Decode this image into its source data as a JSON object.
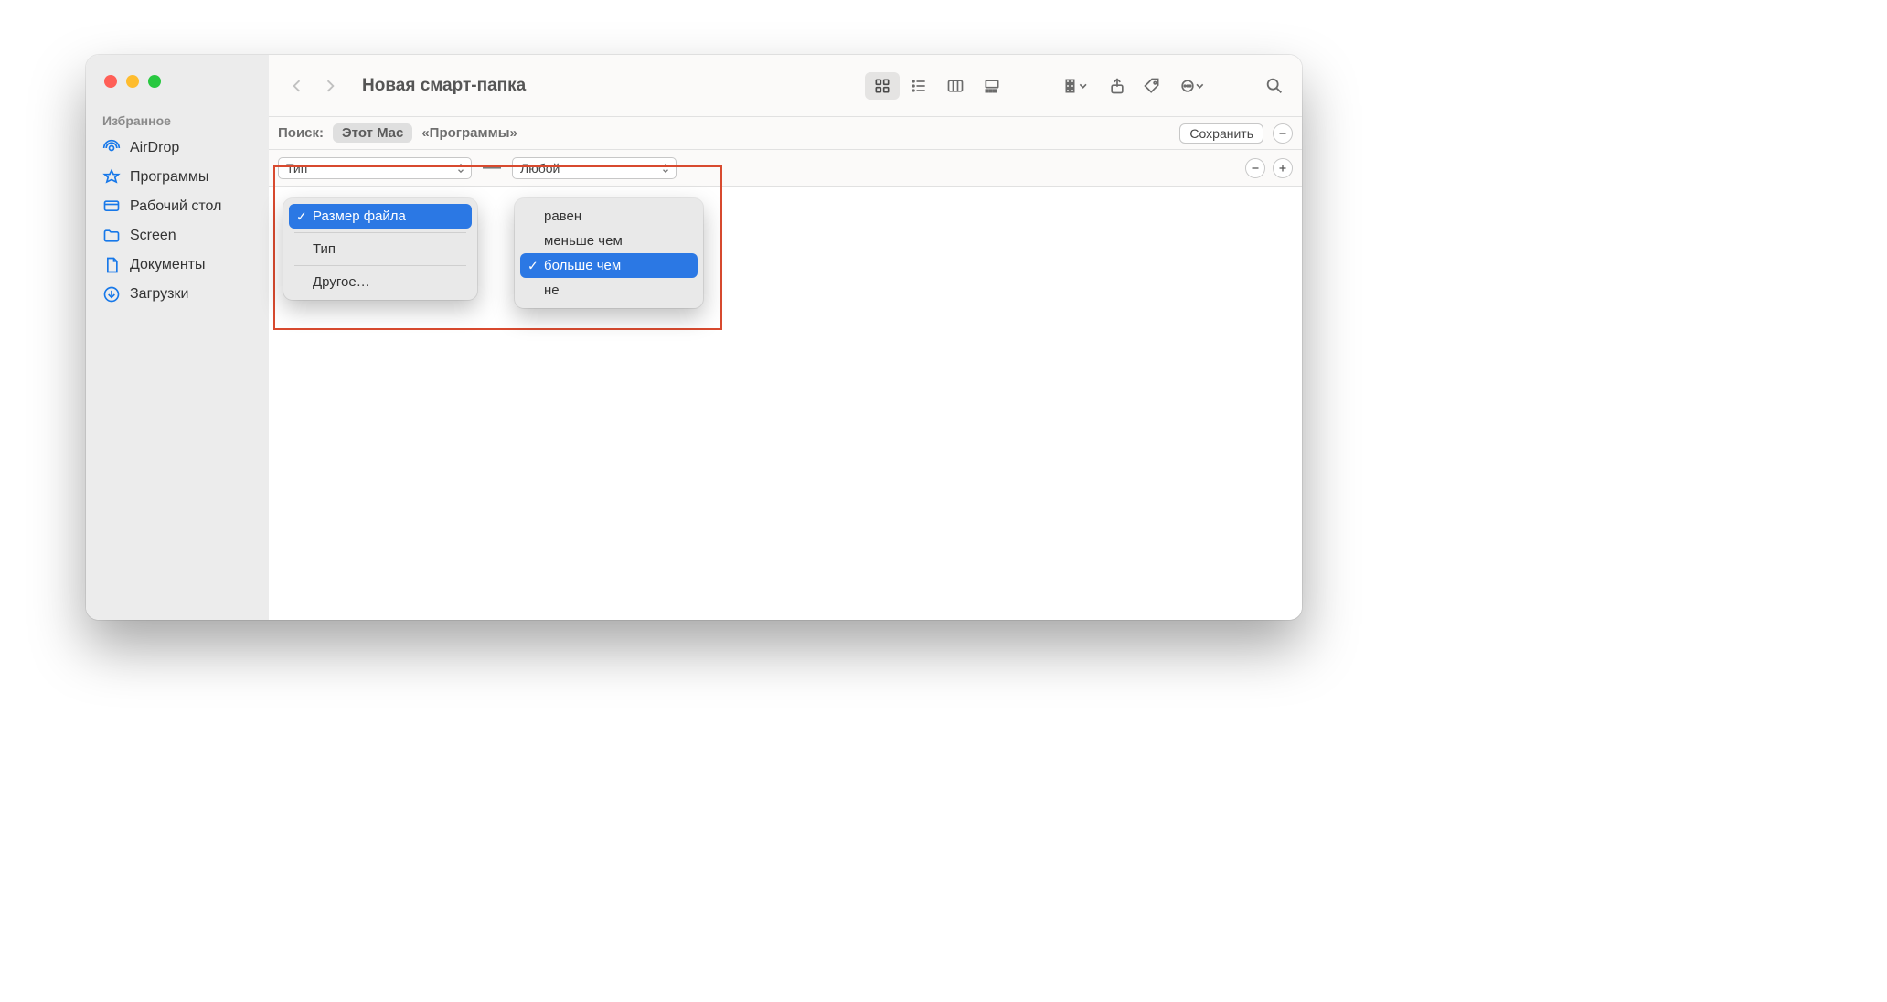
{
  "window": {
    "title": "Новая смарт-папка"
  },
  "sidebar": {
    "section": "Избранное",
    "items": [
      {
        "label": "AirDrop"
      },
      {
        "label": "Программы"
      },
      {
        "label": "Рабочий стол"
      },
      {
        "label": "Screen"
      },
      {
        "label": "Документы"
      },
      {
        "label": "Загрузки"
      }
    ]
  },
  "search": {
    "label": "Поиск:",
    "scope_selected": "Этот Mac",
    "scope_alt": "«Программы»",
    "save_button": "Сохранить"
  },
  "criteria": {
    "attribute_combo": "Тип",
    "separator": "—",
    "value_combo": "Любой"
  },
  "attribute_menu": {
    "items": [
      {
        "label": "Размер файла",
        "selected": true
      },
      {
        "label": "Тип",
        "selected": false
      },
      {
        "label": "Другое…",
        "selected": false
      }
    ]
  },
  "comparator_menu": {
    "items": [
      {
        "label": "равен",
        "selected": false
      },
      {
        "label": "меньше чем",
        "selected": false
      },
      {
        "label": "больше чем",
        "selected": true
      },
      {
        "label": "не",
        "selected": false
      }
    ]
  }
}
